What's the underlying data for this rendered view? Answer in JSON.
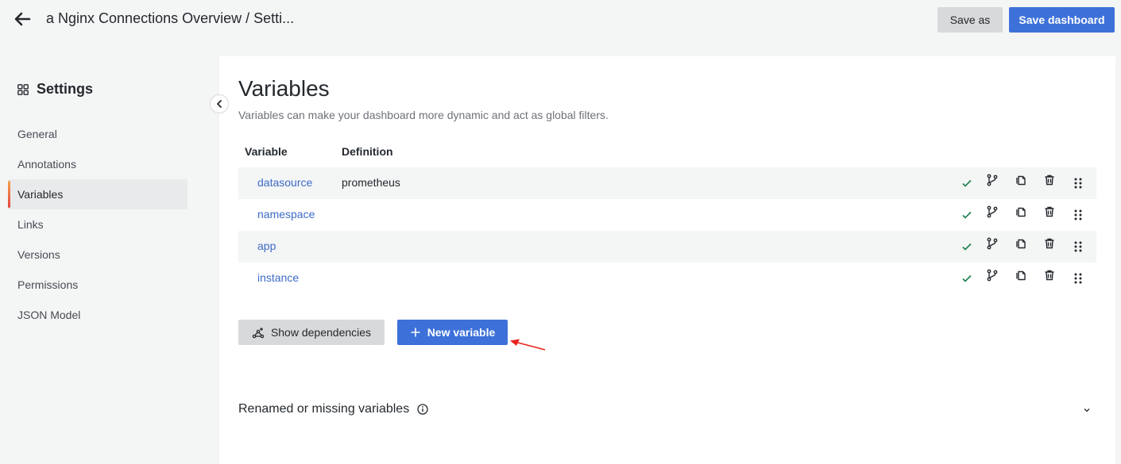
{
  "header": {
    "title": "a Nginx Connections Overview / Setti...",
    "save_as_label": "Save as",
    "save_dashboard_label": "Save dashboard"
  },
  "sidebar": {
    "title": "Settings",
    "items": [
      {
        "label": "General"
      },
      {
        "label": "Annotations"
      },
      {
        "label": "Variables"
      },
      {
        "label": "Links"
      },
      {
        "label": "Versions"
      },
      {
        "label": "Permissions"
      },
      {
        "label": "JSON Model"
      }
    ],
    "active": "Variables"
  },
  "main": {
    "heading": "Variables",
    "subtitle": "Variables can make your dashboard more dynamic and act as global filters.",
    "columns": [
      "Variable",
      "Definition"
    ],
    "rows": [
      {
        "name": "datasource",
        "definition": "prometheus"
      },
      {
        "name": "namespace",
        "definition": ""
      },
      {
        "name": "app",
        "definition": ""
      },
      {
        "name": "instance",
        "definition": ""
      }
    ],
    "show_dependencies_label": "Show dependencies",
    "new_variable_label": "New variable",
    "renamed_label": "Renamed or missing variables"
  },
  "colors": {
    "primary": "#3d71d9",
    "link": "#3d6bc7",
    "check": "#1a7f4b",
    "arrow": "#e8231f"
  },
  "icons": [
    "back-arrow-icon",
    "settings-grid-icon",
    "chevron-left-icon",
    "check-icon",
    "branch-icon",
    "copy-icon",
    "trash-icon",
    "drag-handle-icon",
    "dependencies-icon",
    "plus-icon",
    "info-icon",
    "chevron-down-icon"
  ]
}
